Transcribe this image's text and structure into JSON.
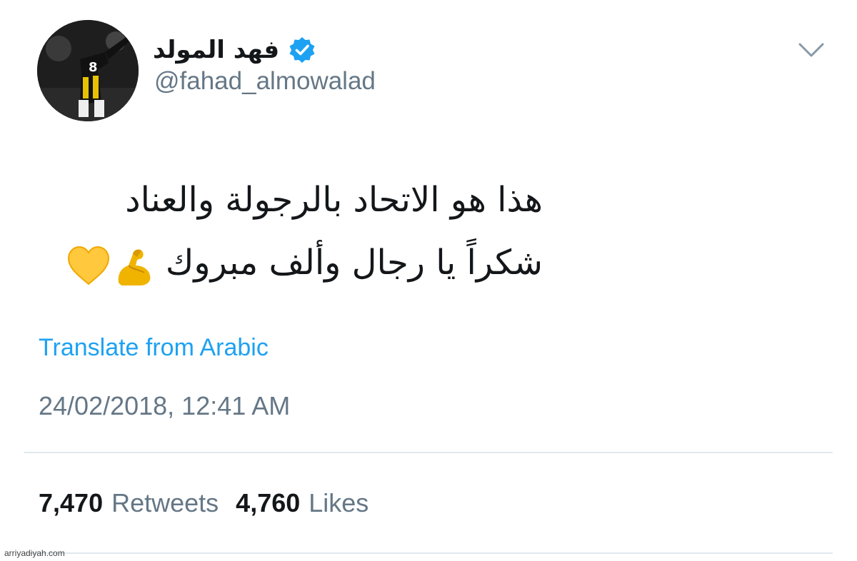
{
  "tweet": {
    "display_name": "فهد المولد",
    "handle": "@fahad_almowalad",
    "verified": true,
    "text_lines": [
      "هذا هو الاتحاد بالرجولة والعناد",
      "شكراً يا رجال وألف مبروك"
    ],
    "emojis": [
      "flexed-biceps-icon",
      "yellow-heart-icon"
    ],
    "translate_label": "Translate from Arabic",
    "timestamp": "24/02/2018, 12:41 AM",
    "retweets_count": "7,470",
    "retweets_label": "Retweets",
    "likes_count": "4,760",
    "likes_label": "Likes"
  },
  "watermark": "arriyadiyah.com",
  "colors": {
    "link": "#1da1f2",
    "secondary_text": "#657786",
    "primary_text": "#14171a",
    "divider": "#e1e8ed",
    "verified_badge": "#1da1f2"
  }
}
